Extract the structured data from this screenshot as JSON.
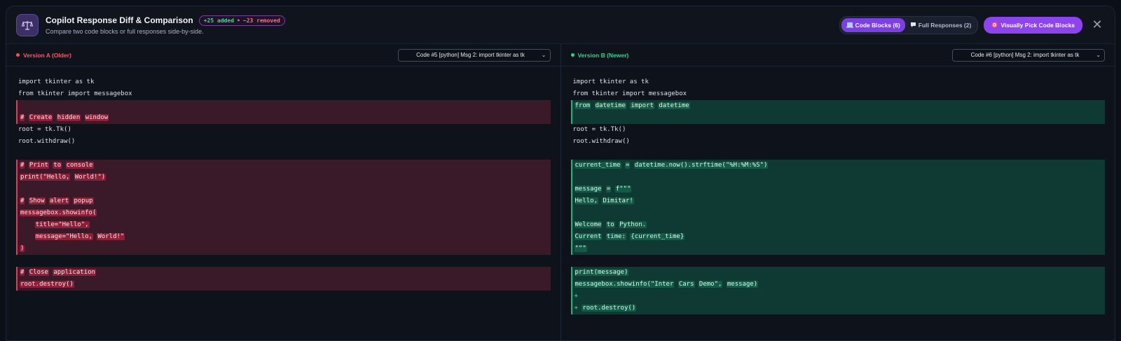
{
  "header": {
    "title": "Copilot Response Diff & Comparison",
    "badge": {
      "added": "+25 added",
      "separator": "•",
      "removed": "−23 removed"
    },
    "subtitle": "Compare two code blocks or full responses side-by-side.",
    "tabs": [
      {
        "label": "Code Blocks (6)",
        "icon": "laptop-icon",
        "active": true
      },
      {
        "label": "Full Responses (2)",
        "icon": "speech-bubble-icon",
        "active": false
      }
    ],
    "pick_button": {
      "label": "Visually Pick Code Blocks",
      "icon": "target-icon"
    },
    "close_glyph": "✕"
  },
  "left": {
    "version_label": "Version A (Older)",
    "select_value": "Code #5 [python] Msg 2: import tkinter as tk",
    "lines": [
      {
        "type": "ctx",
        "text": "import tkinter as tk"
      },
      {
        "type": "ctx",
        "text": "from tkinter import messagebox"
      },
      {
        "type": "del",
        "text": ""
      },
      {
        "type": "del",
        "text": "# Create hidden window"
      },
      {
        "type": "ctx",
        "text": "root = tk.Tk()"
      },
      {
        "type": "ctx",
        "text": "root.withdraw()"
      },
      {
        "type": "blank",
        "text": ""
      },
      {
        "type": "del",
        "text": "# Print to console"
      },
      {
        "type": "del",
        "text": "print(\"Hello, World!\")"
      },
      {
        "type": "del",
        "text": ""
      },
      {
        "type": "del",
        "text": "# Show alert popup"
      },
      {
        "type": "del",
        "text": "messagebox.showinfo("
      },
      {
        "type": "del",
        "text": "    title=\"Hello\","
      },
      {
        "type": "del",
        "text": "    message=\"Hello, World!\""
      },
      {
        "type": "del",
        "text": ")"
      },
      {
        "type": "blank",
        "text": ""
      },
      {
        "type": "del",
        "text": "# Close application"
      },
      {
        "type": "del",
        "text": "root.destroy()"
      }
    ]
  },
  "right": {
    "version_label": "Version B (Newer)",
    "select_value": "Code #6 [python] Msg 2: import tkinter as tk",
    "lines": [
      {
        "type": "ctx",
        "text": "import tkinter as tk"
      },
      {
        "type": "ctx",
        "text": "from tkinter import messagebox"
      },
      {
        "type": "add",
        "text": "from datetime import datetime"
      },
      {
        "type": "add",
        "text": ""
      },
      {
        "type": "ctx",
        "text": "root = tk.Tk()"
      },
      {
        "type": "ctx",
        "text": "root.withdraw()"
      },
      {
        "type": "blank",
        "text": ""
      },
      {
        "type": "add",
        "text": "current_time = datetime.now().strftime(\"%H:%M:%S\")"
      },
      {
        "type": "add",
        "text": ""
      },
      {
        "type": "add",
        "text": "message = f\"\"\""
      },
      {
        "type": "add",
        "text": "Hello, Dimitar!"
      },
      {
        "type": "add",
        "text": ""
      },
      {
        "type": "add",
        "text": "Welcome to Python."
      },
      {
        "type": "add",
        "text": "Current time: {current_time}"
      },
      {
        "type": "add",
        "text": "\"\"\""
      },
      {
        "type": "blank",
        "text": ""
      },
      {
        "type": "add",
        "text": "print(message)"
      },
      {
        "type": "add",
        "text": "messagebox.showinfo(\"Inter Cars Demo\", message)"
      },
      {
        "type": "add",
        "text": "+"
      },
      {
        "type": "add",
        "text": "+ root.destroy()"
      }
    ]
  }
}
